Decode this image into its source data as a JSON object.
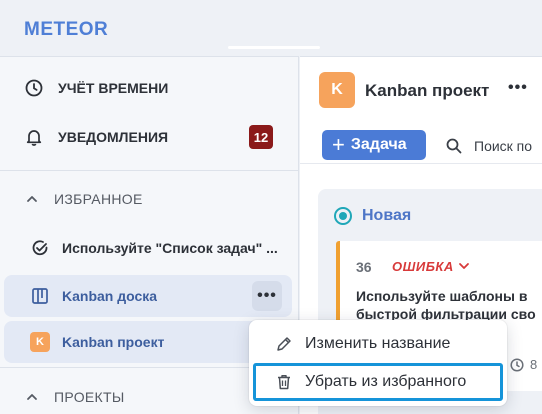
{
  "app": {
    "logo": "METEOR"
  },
  "sidebar": {
    "time_tracking": {
      "label": "УЧЁТ ВРЕМЕНИ",
      "icon": "clock-icon"
    },
    "notifications": {
      "label": "УВЕДОМЛЕНИЯ",
      "icon": "bell-icon",
      "badge": "12",
      "badge_color": "#8b1a1a"
    },
    "favorites": {
      "label": "ИЗБРАННОЕ",
      "items": [
        {
          "label": "Используйте \"Список задач\" ...",
          "icon": "check-circle-icon"
        },
        {
          "label": "Kanban доска",
          "icon": "board-icon"
        },
        {
          "label": "Kanban проект",
          "icon": "project-avatar",
          "avatar_letter": "K"
        }
      ],
      "more_label": "•••"
    },
    "projects": {
      "label": "ПРОЕКТЫ"
    }
  },
  "main": {
    "project": {
      "avatar_letter": "K",
      "title": "Kanban проект",
      "more_label": "•••",
      "avatar_color": "#f6a35c"
    },
    "toolbar": {
      "add_task_label": "Задача",
      "add_task_plus": "+",
      "search_label": "Поиск по"
    },
    "column": {
      "name": "Новая",
      "card": {
        "number": "36",
        "tag": "ОШИБКА",
        "text_line1": "Используйте шаблоны в",
        "text_line2": "быстрой фильтрации сво",
        "meta_count": "8"
      }
    }
  },
  "context_menu": {
    "items": [
      {
        "label": "Изменить название",
        "icon": "pencil-icon"
      },
      {
        "label": "Убрать из избранного",
        "icon": "trash-icon"
      }
    ],
    "highlight_color": "#1594d9"
  },
  "colors": {
    "accent": "#4b7bd6",
    "tag_red": "#d83a3a",
    "card_border": "#f0a030",
    "status_teal": "#1fa7b8"
  }
}
